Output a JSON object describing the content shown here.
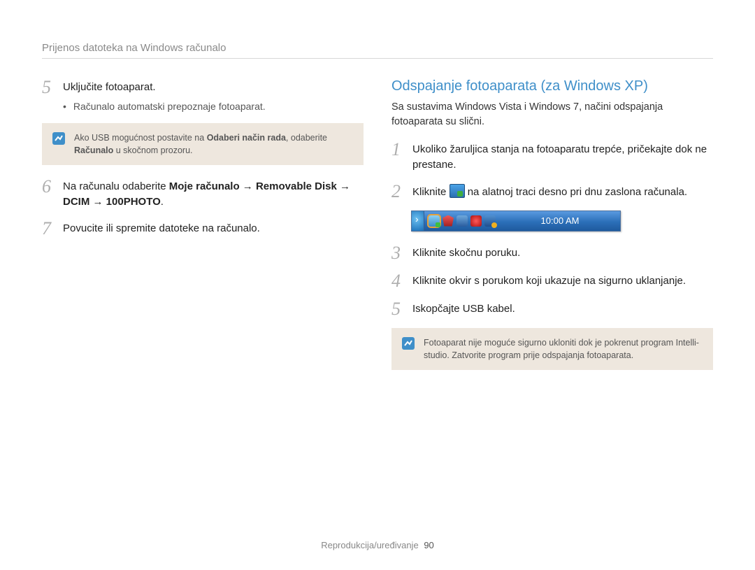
{
  "breadcrumb": "Prijenos datoteka na Windows računalo",
  "left": {
    "step5": {
      "num": "5",
      "text": "Uključite fotoaparat.",
      "bullet": "Računalo automatski prepoznaje fotoaparat."
    },
    "callout1": {
      "pre": "Ako USB mogućnost postavite na ",
      "bold1": "Odaberi način rada",
      "mid": ", odaberite ",
      "bold2": "Računalo",
      "post": " u skočnom prozoru."
    },
    "step6": {
      "num": "6",
      "pre": "Na računalu odaberite ",
      "bold1": "Moje računalo",
      "arrow": " → ",
      "bold2": "Removable Disk",
      "bold3": "DCIM",
      "bold4": "100PHOTO",
      "post": "."
    },
    "step7": {
      "num": "7",
      "text": "Povucite ili spremite datoteke na računalo."
    }
  },
  "right": {
    "title": "Odspajanje fotoaparata (za Windows XP)",
    "intro": "Sa sustavima Windows Vista i Windows 7, načini odspajanja fotoaparata su slični.",
    "step1": {
      "num": "1",
      "text": "Ukoliko žaruljica stanja na fotoaparatu trepće, pričekajte dok ne prestane."
    },
    "step2": {
      "num": "2",
      "pre": "Kliknite ",
      "post": " na alatnoj traci desno pri dnu zaslona računala."
    },
    "tray_time": "10:00 AM",
    "step3": {
      "num": "3",
      "text": "Kliknite skočnu poruku."
    },
    "step4": {
      "num": "4",
      "text": "Kliknite okvir s porukom koji ukazuje na sigurno uklanjanje."
    },
    "step5": {
      "num": "5",
      "text": "Iskopčajte USB kabel."
    },
    "callout2": "Fotoaparat nije moguće sigurno ukloniti dok je pokrenut program Intelli-studio. Zatvorite program prije odspajanja fotoaparata."
  },
  "footer": {
    "label": "Reprodukcija/uređivanje",
    "page": "90"
  }
}
